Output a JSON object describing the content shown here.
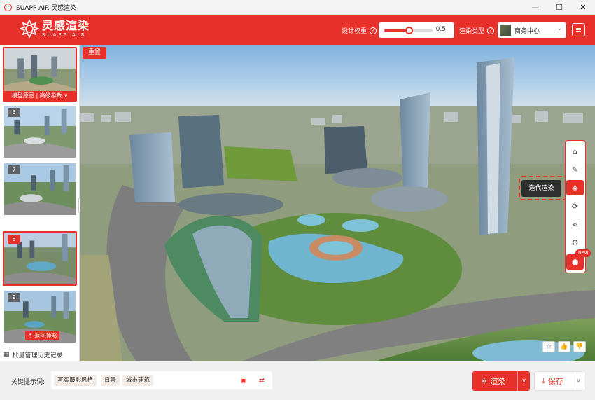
{
  "window": {
    "title": "SUAPP AIR 灵感渲染",
    "minimize": "—",
    "maximize": "☐",
    "close": "✕"
  },
  "header": {
    "logo_cn": "灵感渲染",
    "logo_en": "SUAPP AIR",
    "weight_label": "设计权重",
    "weight_value": "0.5",
    "weight_fraction": 0.5,
    "render_type_label": "渲染类型",
    "render_type_value": "商务中心",
    "help": "?",
    "menu": "≡"
  },
  "sidebar": {
    "items": [
      {
        "num": "",
        "bar": "模型原图 | 高级参数 ∨"
      },
      {
        "num": "6"
      },
      {
        "num": "7"
      },
      {
        "num": "8",
        "active": true
      },
      {
        "num": "9",
        "back": "⇡ 返回顶部"
      }
    ],
    "history": "批量管理历史记录"
  },
  "viewport": {
    "reset": "重置",
    "tooltip": "迭代渲染",
    "tools": [
      "home-icon",
      "edit-icon",
      "layers-icon",
      "refresh-icon",
      "share-icon",
      "settings-icon",
      "cube-icon"
    ],
    "new_badge": "new"
  },
  "bottom": {
    "keyword_label": "关键提示词:",
    "chips": [
      "写实摄影风格",
      "日景",
      "城市建筑"
    ],
    "render": "渲染",
    "save": "保存"
  },
  "colors": {
    "accent": "#e8302a"
  }
}
